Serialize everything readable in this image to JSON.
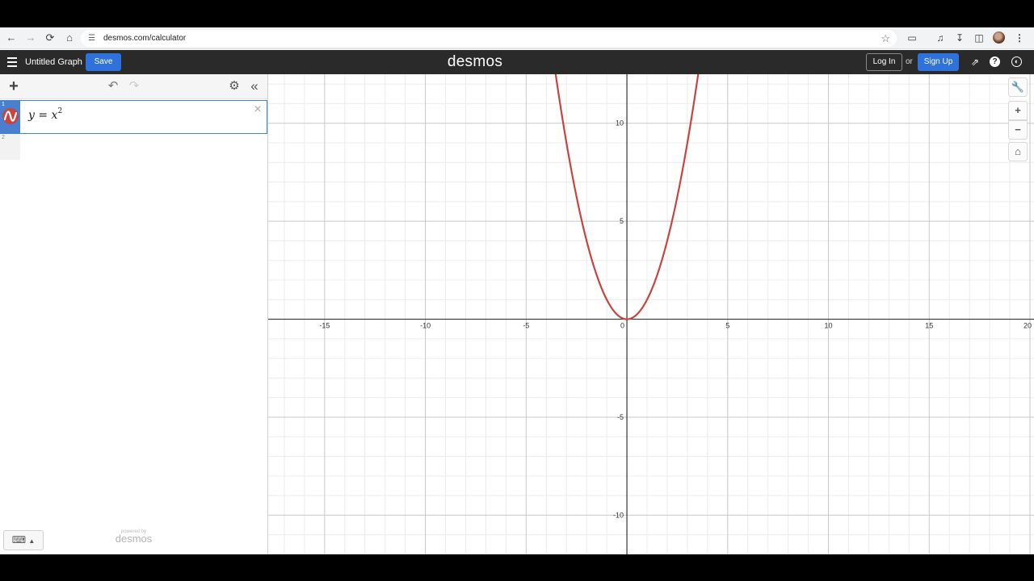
{
  "browser": {
    "url": "desmos.com/calculator",
    "icons": [
      "back-icon",
      "forward-icon",
      "reload-icon",
      "home-icon",
      "site-info-icon",
      "bookmark-star-icon",
      "extensions-icon",
      "media-icon",
      "download-icon",
      "sidepanel-icon",
      "profile-avatar",
      "menu-icon"
    ]
  },
  "header": {
    "graph_title": "Untitled Graph",
    "save_label": "Save",
    "logo": "desmos",
    "login_label": "Log In",
    "or_label": "or",
    "signup_label": "Sign Up",
    "accent_color": "#2f72dc",
    "bar_color": "#2a2a2a"
  },
  "expressions": [
    {
      "index": "1",
      "latex_base": "y = x",
      "exponent": "2",
      "color": "#c74440"
    },
    {
      "index": "2",
      "latex_base": "",
      "exponent": ""
    }
  ],
  "footer": {
    "powered_by": "powered by",
    "brand": "desmos"
  },
  "graph": {
    "x_range": [
      -17.8,
      20.2
    ],
    "y_range": [
      -12,
      12.5
    ],
    "x_ticks": [
      "-15",
      "-10",
      "-5",
      "0",
      "5",
      "10",
      "15",
      "20"
    ],
    "x_tick_values": [
      -15,
      -10,
      -5,
      0,
      5,
      10,
      15,
      20
    ],
    "y_ticks": [
      "10",
      "5",
      "-5",
      "-10"
    ],
    "y_tick_values": [
      10,
      5,
      -5,
      -10
    ],
    "curve_expression": "y=x^2",
    "curve_color": "#c74440"
  }
}
